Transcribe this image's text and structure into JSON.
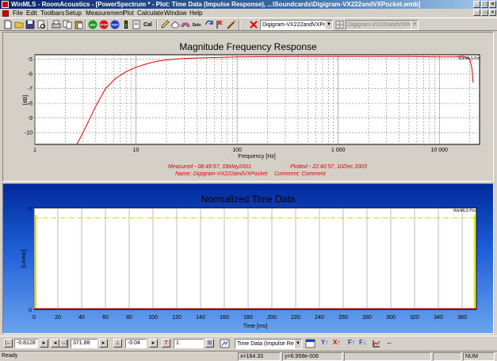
{
  "window": {
    "title": "WinMLS - RoomAcoustics - [PowerSpectrum * - Plot: Time Data (Impulse Response), ...\\Soundcards\\Digigram-VX222andVXPocket.wmb]",
    "min": "_",
    "max": "□",
    "close": "×"
  },
  "menu": [
    "File",
    "Edit",
    "Toolbars",
    "Setup",
    "Measurement",
    "Plot",
    "Calculate",
    "Window",
    "Help"
  ],
  "toolbar": {
    "icons": [
      "new-icon",
      "open-icon",
      "save-icon",
      "print-preview-icon",
      "print-icon",
      "copy-icon",
      "paste-icon",
      "go-icon",
      "stop-icon",
      "test-icon",
      "level-meter-icon",
      "clipboard-icon",
      "calibrate-icon",
      "edit-icon",
      "erase-icon",
      "waves-icon",
      "solo-icon",
      "refresh-icon",
      "flag-icon",
      "load-icon"
    ],
    "go_label": "GO",
    "stop_label": "STOP",
    "test_label": "TEST",
    "cal_label": "Cal",
    "solo_label": "Solo",
    "device_combo": "Digigram-VX222andVXPock",
    "device_combo_disabled": "Digigram-VX222andVXPock"
  },
  "plot1": {
    "chart_data": {
      "type": "line",
      "title": "Magnitude Frequency Response",
      "xlabel": "Frequency [Hz]",
      "ylabel": "[dB]",
      "xscale": "log",
      "xlim": [
        1,
        25000
      ],
      "ylim": [
        -10.8,
        -4.7
      ],
      "xticks": [
        "1",
        "10",
        "100",
        "1 000",
        "10 000"
      ],
      "yticks": [
        -5,
        -6,
        -7,
        -8,
        -9,
        -10
      ],
      "grid": true,
      "series": [
        {
          "color": "#e00000",
          "x": [
            2.6,
            3.2,
            4.0,
            5.0,
            6.3,
            8.0,
            10,
            13,
            16,
            20,
            30,
            50,
            100,
            200,
            500,
            1000,
            2000,
            5000,
            10000,
            14000,
            17000,
            19000,
            20000,
            21000,
            21600
          ],
          "y": [
            -10.8,
            -9.6,
            -8.2,
            -7.0,
            -6.3,
            -5.85,
            -5.55,
            -5.3,
            -5.15,
            -5.05,
            -4.95,
            -4.9,
            -4.85,
            -4.83,
            -4.82,
            -4.82,
            -4.82,
            -4.82,
            -4.85,
            -4.85,
            -4.8,
            -4.9,
            -5.0,
            -5.6,
            -6.6
          ]
        }
      ],
      "watermark": "WinMLS Pro"
    },
    "info": {
      "measured": "Measured - 08:49:57, 09May2001",
      "plotted": "Plotted - 22:40:57, 10Dec 2003",
      "name": "Name: Digigram-VX222andVXPocket",
      "comment": "Comment: Comment"
    }
  },
  "plot2": {
    "chart_data": {
      "type": "line",
      "title": "Normalized Time Data",
      "xlabel": "Time [ms]",
      "ylabel": "[Linear]",
      "xlim": [
        0,
        372
      ],
      "ylim": [
        0,
        1
      ],
      "xticks": [
        0,
        20,
        40,
        60,
        80,
        100,
        120,
        140,
        160,
        180,
        200,
        220,
        240,
        260,
        280,
        300,
        320,
        340,
        360
      ],
      "yticks": [
        0,
        1
      ],
      "grid": true,
      "markers": {
        "left_cursor": 0,
        "right_cursor": 371.88,
        "level_line": 0.9
      },
      "watermark": "WinMLS Pro"
    }
  },
  "bottombar": {
    "left_value": "-0.8128",
    "right_value": "371.88",
    "level_value": "-0.04",
    "step_value": "1",
    "plot_type": "Time Data (Impulse Resp",
    "buttons": [
      "Y↑",
      "X↑",
      "F↑",
      "F↓",
      "←"
    ]
  },
  "status": {
    "ready": "Ready",
    "x": "x=164.33",
    "y": "y=6.958e-006",
    "num": "NUM"
  }
}
